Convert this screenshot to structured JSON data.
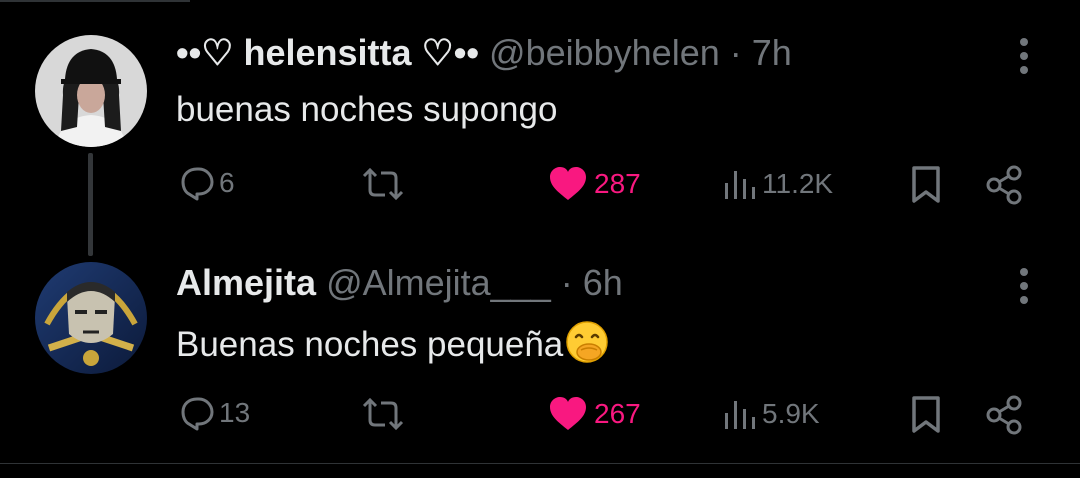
{
  "tweets": [
    {
      "display_name": "••♡ helensitta ♡••",
      "handle": "@beibbyhelen",
      "separator": "·",
      "time": "7h",
      "text": "buenas noches supongo",
      "reply_count": "6",
      "like_count": "287",
      "view_count": "11.2K"
    },
    {
      "display_name": "Almejita",
      "handle": "@Almejita___",
      "separator": "·",
      "time": "6h",
      "text": "Buenas noches pequeña",
      "emoji": "🤭",
      "reply_count": "13",
      "like_count": "267",
      "view_count": "5.9K"
    }
  ],
  "colors": {
    "background": "#000000",
    "text_primary": "#e7e9ea",
    "text_secondary": "#71767b",
    "like_active": "#f91880",
    "divider": "#2f3336"
  },
  "icons": [
    "reply-icon",
    "retweet-icon",
    "heart-icon",
    "views-icon",
    "bookmark-icon",
    "share-icon",
    "more-icon"
  ]
}
